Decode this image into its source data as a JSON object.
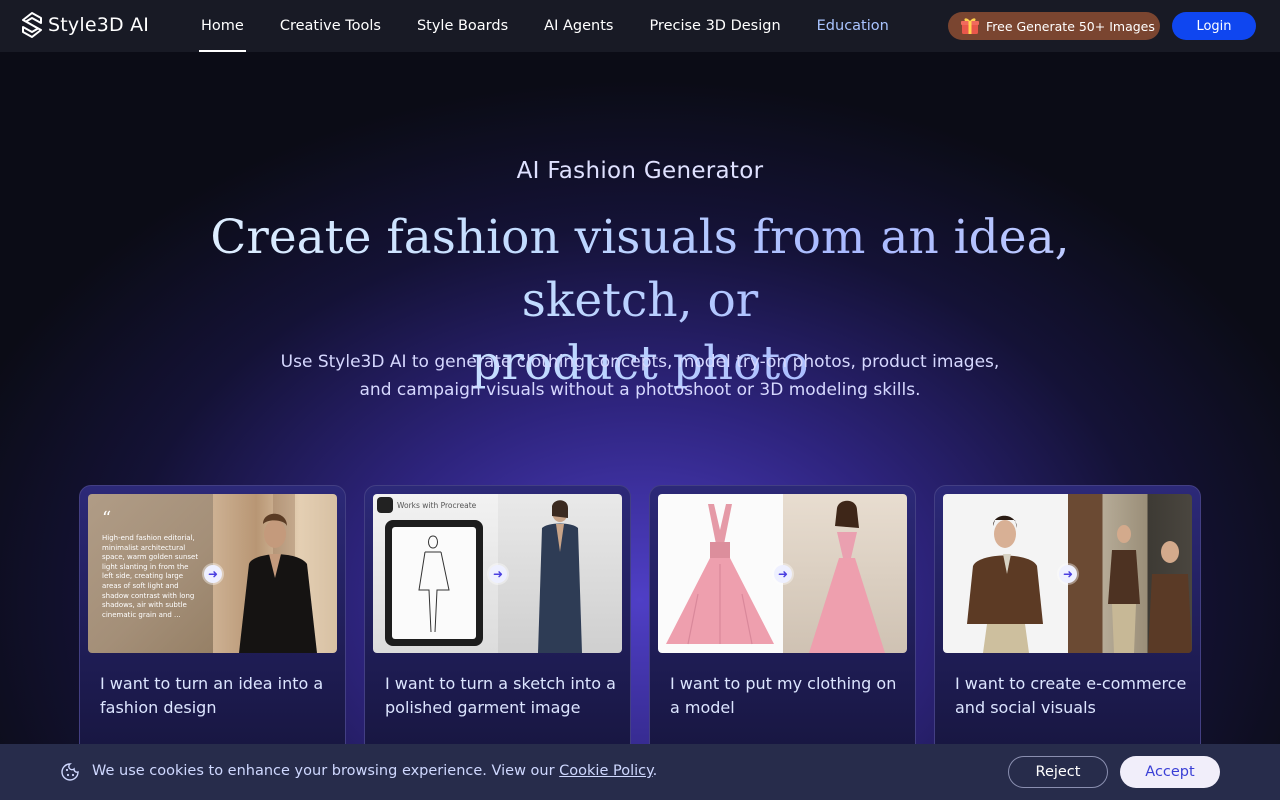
{
  "nav": {
    "brand": "Style3D AI",
    "links": [
      {
        "label": "Home"
      },
      {
        "label": "Creative Tools"
      },
      {
        "label": "Style Boards"
      },
      {
        "label": "AI Agents"
      },
      {
        "label": "Precise 3D Design"
      },
      {
        "label": "Education"
      }
    ],
    "active_link": "Home",
    "promo_label": "Free Generate 50+ Images",
    "promo_icon": "gift-icon",
    "login_label": "Login"
  },
  "hero": {
    "eyebrow": "AI Fashion Generator",
    "headline_line1": "Create fashion visuals from an idea, sketch, or",
    "headline_line2": "product photo",
    "subtitle_line1": "Use Style3D AI to generate clothing concepts, model try-on photos, product images,",
    "subtitle_line2": "and campaign visuals without a photoshoot or 3D modeling skills."
  },
  "cards": [
    {
      "title": "I want to turn an idea into a fashion design",
      "prompt_text": "High-end fashion editorial, minimalist architectural space, warm golden sunset light slanting in from the left side, creating large areas of soft light and shadow contrast with long shadows, air with subtle cinematic grain and ..."
    },
    {
      "title": "I want to turn a sketch into a polished garment image",
      "badge": "Works with Procreate"
    },
    {
      "title": "I want to put my clothing on a model"
    },
    {
      "title": "I want to create e-commerce and social visuals"
    }
  ],
  "cookie": {
    "message": "We use cookies to enhance your browsing experience. View our ",
    "link_label": "Cookie Policy",
    "period": ".",
    "reject_label": "Reject",
    "accept_label": "Accept"
  },
  "colors": {
    "nav_bg": "#181a25",
    "login_bg": "#0f46f0",
    "promo_bg": "#7a4530",
    "education_link": "#a9c4ff",
    "cookie_bg": "#272c4b"
  }
}
